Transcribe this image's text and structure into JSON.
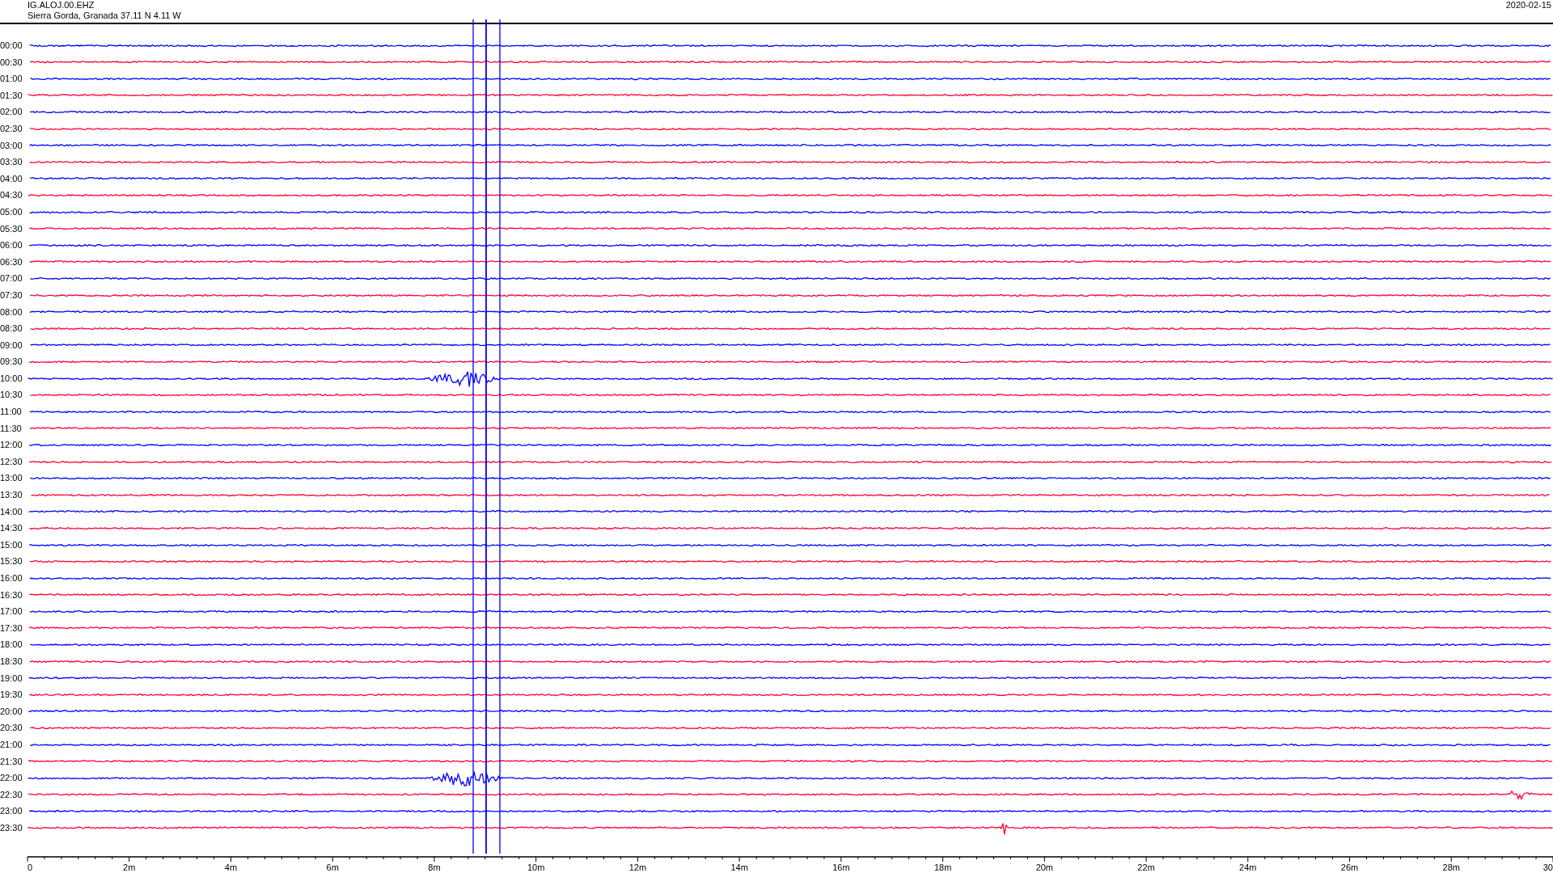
{
  "header": {
    "station": "IG.ALOJ.00.EHZ",
    "location": "Sierra Gorda, Granada  37.11 N 4.11 W",
    "date": "2020-02-15"
  },
  "rows": [
    {
      "label": "00:00",
      "color": "#0000ff"
    },
    {
      "label": "00:30",
      "color": "#ff0033"
    },
    {
      "label": "01:00",
      "color": "#0000ff"
    },
    {
      "label": "01:30",
      "color": "#ff0033"
    },
    {
      "label": "02:00",
      "color": "#0000ff"
    },
    {
      "label": "02:30",
      "color": "#ff0033"
    },
    {
      "label": "03:00",
      "color": "#0000ff"
    },
    {
      "label": "03:30",
      "color": "#ff0033"
    },
    {
      "label": "04:00",
      "color": "#0000ff"
    },
    {
      "label": "04:30",
      "color": "#ff0033"
    },
    {
      "label": "05:00",
      "color": "#0000ff"
    },
    {
      "label": "05:30",
      "color": "#ff0033"
    },
    {
      "label": "06:00",
      "color": "#0000ff"
    },
    {
      "label": "06:30",
      "color": "#ff0033"
    },
    {
      "label": "07:00",
      "color": "#0000ff"
    },
    {
      "label": "07:30",
      "color": "#ff0033"
    },
    {
      "label": "08:00",
      "color": "#0000ff"
    },
    {
      "label": "08:30",
      "color": "#ff0033"
    },
    {
      "label": "09:00",
      "color": "#0000ff"
    },
    {
      "label": "09:30",
      "color": "#ff0033"
    },
    {
      "label": "10:00",
      "color": "#0000ff"
    },
    {
      "label": "10:30",
      "color": "#ff0033"
    },
    {
      "label": "11:00",
      "color": "#0000ff"
    },
    {
      "label": "11:30",
      "color": "#ff0033"
    },
    {
      "label": "12:00",
      "color": "#0000ff"
    },
    {
      "label": "12:30",
      "color": "#ff0033"
    },
    {
      "label": "13:00",
      "color": "#0000ff"
    },
    {
      "label": "13:30",
      "color": "#ff0033"
    },
    {
      "label": "14:00",
      "color": "#0000ff"
    },
    {
      "label": "14:30",
      "color": "#ff0033"
    },
    {
      "label": "15:00",
      "color": "#0000ff"
    },
    {
      "label": "15:30",
      "color": "#ff0033"
    },
    {
      "label": "16:00",
      "color": "#0000ff"
    },
    {
      "label": "16:30",
      "color": "#ff0033"
    },
    {
      "label": "17:00",
      "color": "#0000ff"
    },
    {
      "label": "17:30",
      "color": "#ff0033"
    },
    {
      "label": "18:00",
      "color": "#0000ff"
    },
    {
      "label": "18:30",
      "color": "#ff0033"
    },
    {
      "label": "19:00",
      "color": "#0000ff"
    },
    {
      "label": "19:30",
      "color": "#ff0033"
    },
    {
      "label": "20:00",
      "color": "#0000ff"
    },
    {
      "label": "20:30",
      "color": "#ff0033"
    },
    {
      "label": "21:00",
      "color": "#0000ff"
    },
    {
      "label": "21:30",
      "color": "#ff0033"
    },
    {
      "label": "22:00",
      "color": "#0000ff"
    },
    {
      "label": "22:30",
      "color": "#ff0033"
    },
    {
      "label": "23:00",
      "color": "#0000ff"
    },
    {
      "label": "23:30",
      "color": "#ff0033"
    }
  ],
  "axis": {
    "labels": [
      "0",
      "2m",
      "4m",
      "6m",
      "8m",
      "10m",
      "12m",
      "14m",
      "16m",
      "18m",
      "20m",
      "22m",
      "24m",
      "26m",
      "28m",
      "30"
    ]
  }
}
